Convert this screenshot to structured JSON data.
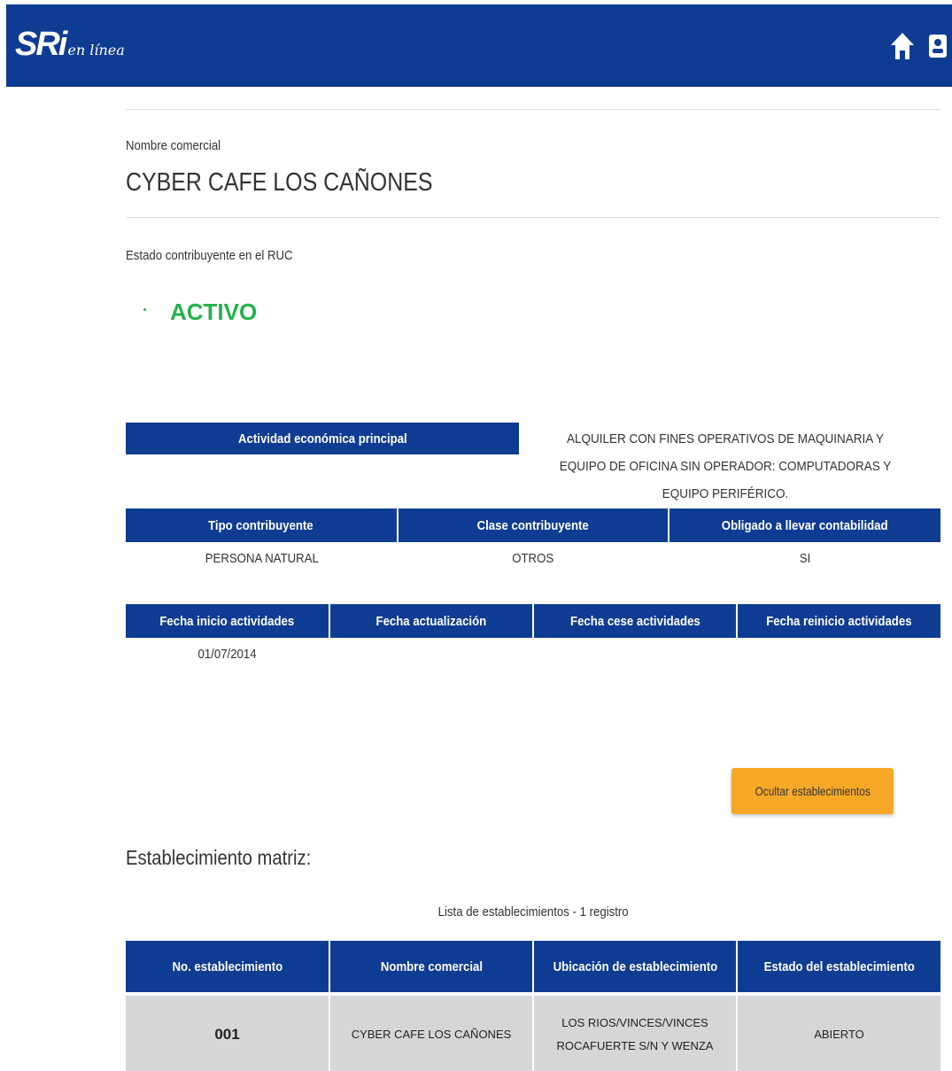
{
  "header": {
    "logo_main": "SRi",
    "logo_sub": "en línea",
    "icons": [
      "home-icon",
      "user-icon"
    ],
    "bg_color": "#0f3c93"
  },
  "taxpayer": {
    "trade_name_label": "Nombre comercial",
    "trade_name": "CYBER CAFE LOS CAÑONES",
    "status_label": "Estado contribuyente en el RUC",
    "status": "ACTIVO",
    "status_color": "#23b24b"
  },
  "activity": {
    "label": "Actividad económica principal",
    "description": "ALQUILER CON FINES OPERATIVOS DE MAQUINARIA Y EQUIPO DE OFICINA SIN OPERADOR: COMPUTADORAS Y EQUIPO PERIFÉRICO."
  },
  "type_table": {
    "headers": [
      "Tipo contribuyente",
      "Clase contribuyente",
      "Obligado a llevar contabilidad"
    ],
    "values": [
      "PERSONA NATURAL",
      "OTROS",
      "SI"
    ]
  },
  "dates_table": {
    "headers": [
      "Fecha inicio actividades",
      "Fecha actualización",
      "Fecha cese actividades",
      "Fecha reinicio actividades"
    ],
    "values": [
      "01/07/2014",
      "",
      "",
      ""
    ]
  },
  "actions": {
    "hide_establishments_label": "Ocultar establecimientos",
    "accent_color": "#f7a826"
  },
  "establishments": {
    "title": "Establecimiento matriz:",
    "caption": "Lista de establecimientos - 1 registro",
    "headers": [
      "No. establecimiento",
      "Nombre comercial",
      "Ubicación de establecimiento",
      "Estado del establecimiento"
    ],
    "rows": [
      {
        "number": "001",
        "name": "CYBER CAFE LOS CAÑONES",
        "location": "LOS RIOS/VINCES/VINCES ROCAFUERTE S/N Y WENZA",
        "status": "ABIERTO"
      }
    ]
  }
}
